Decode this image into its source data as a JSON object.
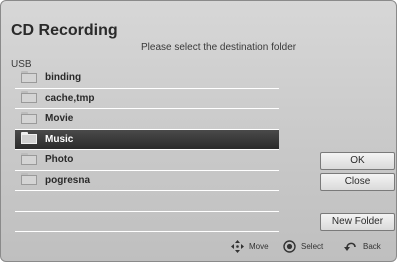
{
  "dialog": {
    "title": "CD Recording",
    "instruction": "Please select the destination folder",
    "device": "USB"
  },
  "folders": [
    {
      "name": "binding",
      "selected": false
    },
    {
      "name": "cache,tmp",
      "selected": false
    },
    {
      "name": "Movie",
      "selected": false
    },
    {
      "name": "Music",
      "selected": true
    },
    {
      "name": "Photo",
      "selected": false
    },
    {
      "name": "pogresna",
      "selected": false
    }
  ],
  "buttons": {
    "ok": "OK",
    "close": "Close",
    "new_folder": "New Folder"
  },
  "hints": {
    "move": "Move",
    "select": "Select",
    "back": "Back"
  },
  "icons": {
    "folder": "folder-icon",
    "move": "arrow-cross-icon",
    "select": "enter-button-icon",
    "back": "return-arrow-icon"
  }
}
